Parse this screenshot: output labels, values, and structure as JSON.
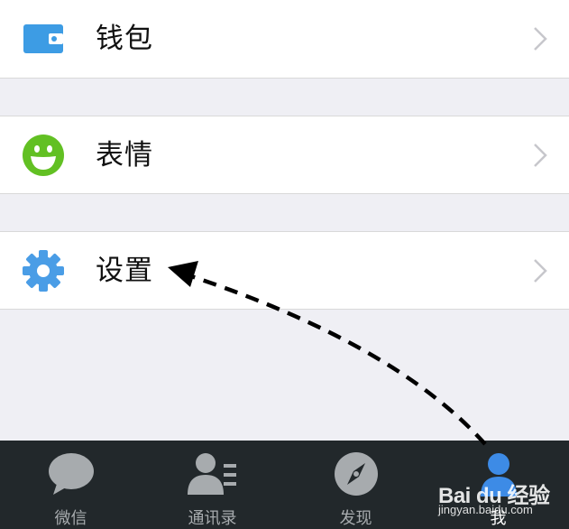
{
  "menu": [
    {
      "label": "钱包",
      "icon": "wallet-icon",
      "color": "#3d9ce4"
    },
    {
      "label": "表情",
      "icon": "smiley-icon",
      "color": "#62c023"
    },
    {
      "label": "设置",
      "icon": "gear-icon",
      "color": "#4a9de6"
    }
  ],
  "tabs": [
    {
      "label": "微信",
      "icon": "chat-bubble-icon"
    },
    {
      "label": "通讯录",
      "icon": "contacts-icon"
    },
    {
      "label": "发现",
      "icon": "compass-icon"
    },
    {
      "label": "我",
      "icon": "person-icon",
      "active": true
    }
  ],
  "watermark": {
    "logo": "Bai du 经验",
    "url": "jingyan.baidu.com"
  },
  "colors": {
    "background": "#efeff4",
    "tab_bar": "#22282b",
    "tab_inactive": "#a7abae",
    "tab_active": "#ffffff"
  }
}
